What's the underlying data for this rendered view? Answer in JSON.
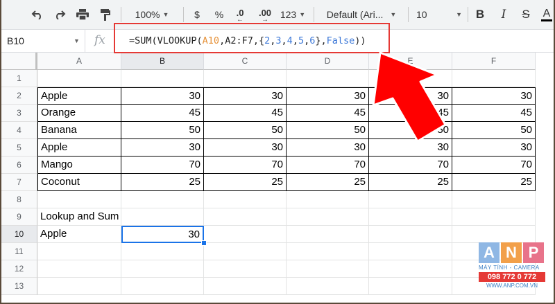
{
  "toolbar": {
    "zoom": "100%",
    "currency": "$",
    "percent": "%",
    "dec_decrease": ".0",
    "dec_increase": ".00",
    "format_more": "123",
    "font": "Default (Ari...",
    "font_size": "10",
    "bold": "B",
    "italic": "I",
    "strike": "S",
    "text_color": "A"
  },
  "formula_bar": {
    "cell_ref": "B10",
    "fx": "fx",
    "formula_parts": [
      {
        "t": "=SUM(VLOOKUP(",
        "k": "plain"
      },
      {
        "t": "A10",
        "k": "ref"
      },
      {
        "t": ",A2:F7,{",
        "k": "plain"
      },
      {
        "t": "2",
        "k": "num"
      },
      {
        "t": ",",
        "k": "plain"
      },
      {
        "t": "3",
        "k": "num"
      },
      {
        "t": ",",
        "k": "plain"
      },
      {
        "t": "4",
        "k": "num"
      },
      {
        "t": ",",
        "k": "plain"
      },
      {
        "t": "5",
        "k": "num"
      },
      {
        "t": ",",
        "k": "plain"
      },
      {
        "t": "6",
        "k": "num"
      },
      {
        "t": "},",
        "k": "plain"
      },
      {
        "t": "False",
        "k": "num"
      },
      {
        "t": "))",
        "k": "plain"
      }
    ]
  },
  "columns": [
    "A",
    "B",
    "C",
    "D",
    "E",
    "F"
  ],
  "rows": [
    "1",
    "2",
    "3",
    "4",
    "5",
    "6",
    "7",
    "8",
    "9",
    "10",
    "11",
    "12",
    "13"
  ],
  "table": [
    [
      "Apple",
      "30",
      "30",
      "30",
      "30",
      "30"
    ],
    [
      "Orange",
      "45",
      "45",
      "45",
      "45",
      "45"
    ],
    [
      "Banana",
      "50",
      "50",
      "50",
      "50",
      "50"
    ],
    [
      "Apple",
      "30",
      "30",
      "30",
      "30",
      "30"
    ],
    [
      "Mango",
      "70",
      "70",
      "70",
      "70",
      "70"
    ],
    [
      "Coconut",
      "25",
      "25",
      "25",
      "25",
      "25"
    ]
  ],
  "lookup": {
    "heading": "Lookup and Sum",
    "key": "Apple",
    "result": "30"
  },
  "logo": {
    "letters": [
      "A",
      "N",
      "P"
    ],
    "tagline": "MÁY TÍNH - CAMERA",
    "phone": "098 772 0 772",
    "website": "WWW.ANP.COM.VN"
  },
  "colors": {
    "highlight_box": "#e53935",
    "arrow": "#ff0000",
    "selection": "#1a73e8"
  }
}
